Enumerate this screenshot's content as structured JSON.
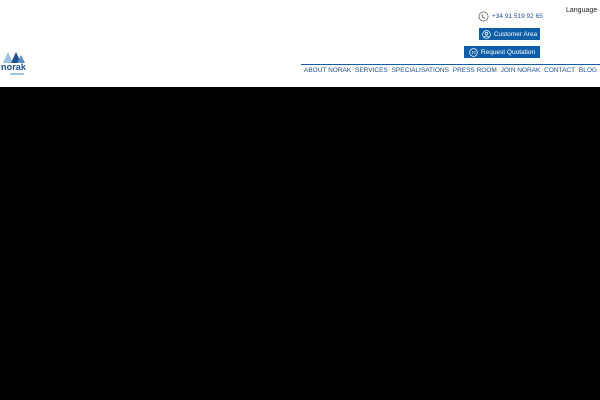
{
  "header": {
    "logo_text": "norak",
    "language": "Language",
    "phone": "+34 91 519 92 65",
    "customer_area": "Customer Area",
    "request_quotation": "Request Quotation"
  },
  "nav": {
    "items": [
      "ABOUT NORAK",
      "SERVICES",
      "SPECIALISATIONS",
      "PRESS ROOM",
      "JOIN NORAK",
      "CONTACT",
      "BLOG"
    ]
  },
  "colors": {
    "brand_blue": "#0f5ea8",
    "text_blue": "#1d4f91",
    "hero_bg": "#000000"
  },
  "icons": [
    "phone-icon",
    "user-circle-icon",
    "quote-icon",
    "logo-mark"
  ]
}
